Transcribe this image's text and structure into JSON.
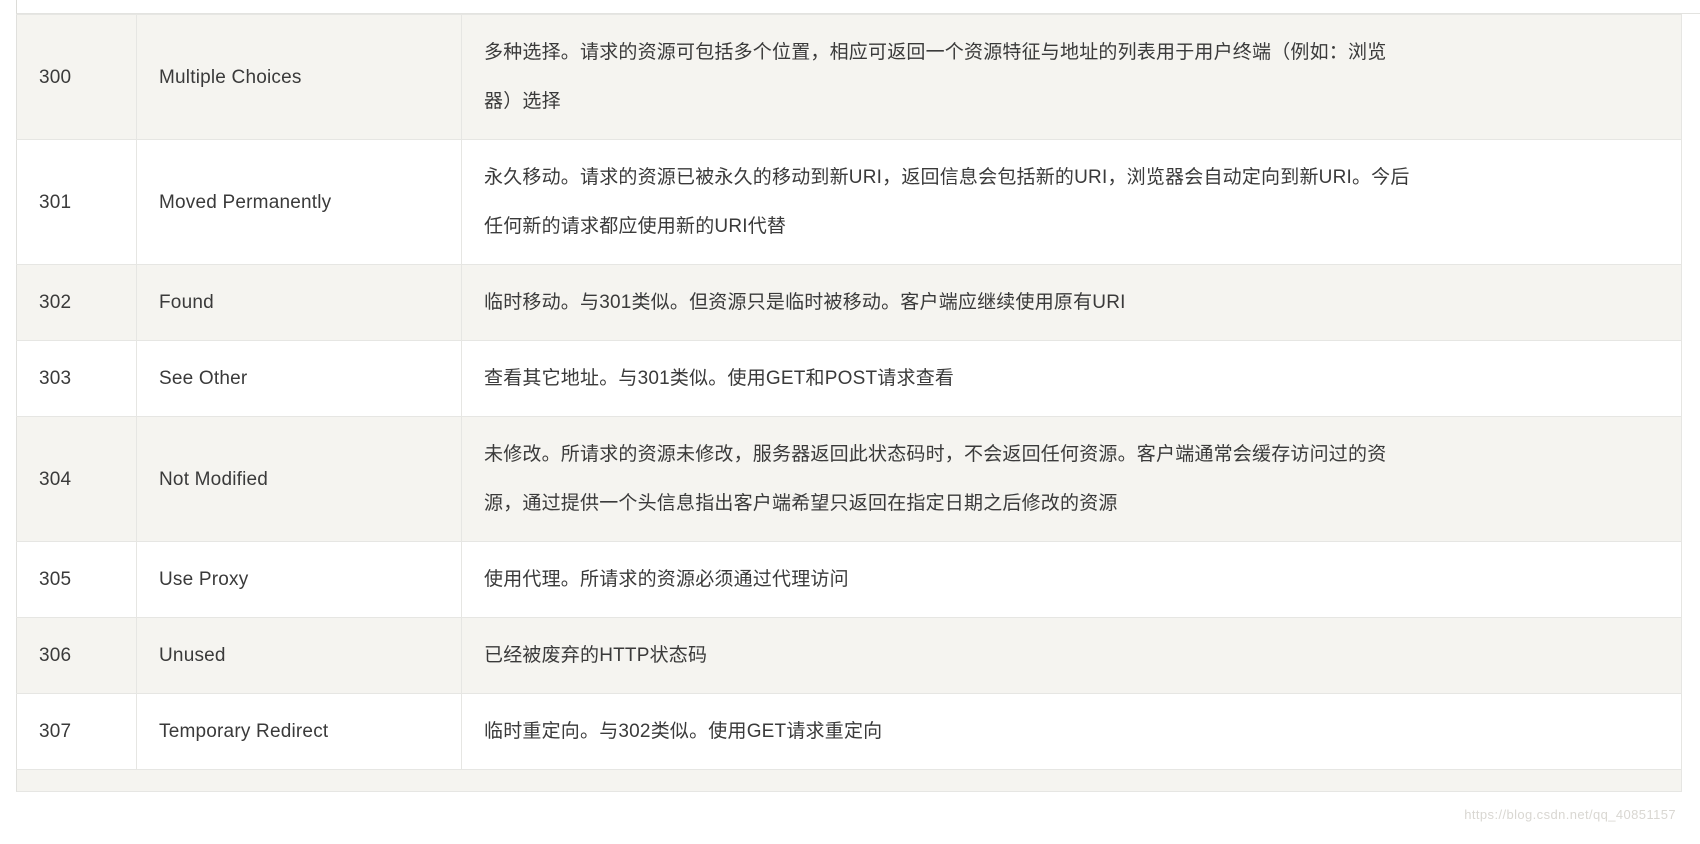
{
  "document": {
    "type": "http-status-code-table",
    "watermark": "https://blog.csdn.net/qq_40851157"
  },
  "table": {
    "rows": [
      {
        "code": "300",
        "name": "Multiple Choices",
        "desc_lines": [
          "多种选择。请求的资源可包括多个位置，相应可返回一个资源特征与地址的列表用于用户终端（例如：浏览",
          "器）选择"
        ],
        "desc": "多种选择。请求的资源可包括多个位置，相应可返回一个资源特征与地址的列表用于用户终端（例如：浏览器）选择",
        "shade": "alt",
        "lines": 2
      },
      {
        "code": "301",
        "name": "Moved Permanently",
        "desc_lines": [
          "永久移动。请求的资源已被永久的移动到新URI，返回信息会包括新的URI，浏览器会自动定向到新URI。今后",
          "任何新的请求都应使用新的URI代替"
        ],
        "desc": "永久移动。请求的资源已被永久的移动到新URI，返回信息会包括新的URI，浏览器会自动定向到新URI。今后任何新的请求都应使用新的URI代替",
        "shade": "plain",
        "lines": 2
      },
      {
        "code": "302",
        "name": "Found",
        "desc_lines": [
          "临时移动。与301类似。但资源只是临时被移动。客户端应继续使用原有URI"
        ],
        "desc": "临时移动。与301类似。但资源只是临时被移动。客户端应继续使用原有URI",
        "shade": "alt",
        "lines": 1
      },
      {
        "code": "303",
        "name": "See Other",
        "desc_lines": [
          "查看其它地址。与301类似。使用GET和POST请求查看"
        ],
        "desc": "查看其它地址。与301类似。使用GET和POST请求查看",
        "shade": "plain",
        "lines": 1
      },
      {
        "code": "304",
        "name": "Not Modified",
        "desc_lines": [
          "未修改。所请求的资源未修改，服务器返回此状态码时，不会返回任何资源。客户端通常会缓存访问过的资",
          "源，通过提供一个头信息指出客户端希望只返回在指定日期之后修改的资源"
        ],
        "desc": "未修改。所请求的资源未修改，服务器返回此状态码时，不会返回任何资源。客户端通常会缓存访问过的资源，通过提供一个头信息指出客户端希望只返回在指定日期之后修改的资源",
        "shade": "alt",
        "lines": 2
      },
      {
        "code": "305",
        "name": "Use Proxy",
        "desc_lines": [
          "使用代理。所请求的资源必须通过代理访问"
        ],
        "desc": "使用代理。所请求的资源必须通过代理访问",
        "shade": "plain",
        "lines": 1
      },
      {
        "code": "306",
        "name": "Unused",
        "desc_lines": [
          "已经被废弃的HTTP状态码"
        ],
        "desc": "已经被废弃的HTTP状态码",
        "shade": "alt",
        "lines": 1
      },
      {
        "code": "307",
        "name": "Temporary Redirect",
        "desc_lines": [
          "临时重定向。与302类似。使用GET请求重定向"
        ],
        "desc": "临时重定向。与302类似。使用GET请求重定向",
        "shade": "plain",
        "lines": 1
      }
    ]
  },
  "colors": {
    "row_alt_background": "#f5f4f0",
    "row_plain_background": "#ffffff",
    "border": "#e6e6e3",
    "text": "#3a3a3a",
    "watermark": "#d9d7d2"
  }
}
